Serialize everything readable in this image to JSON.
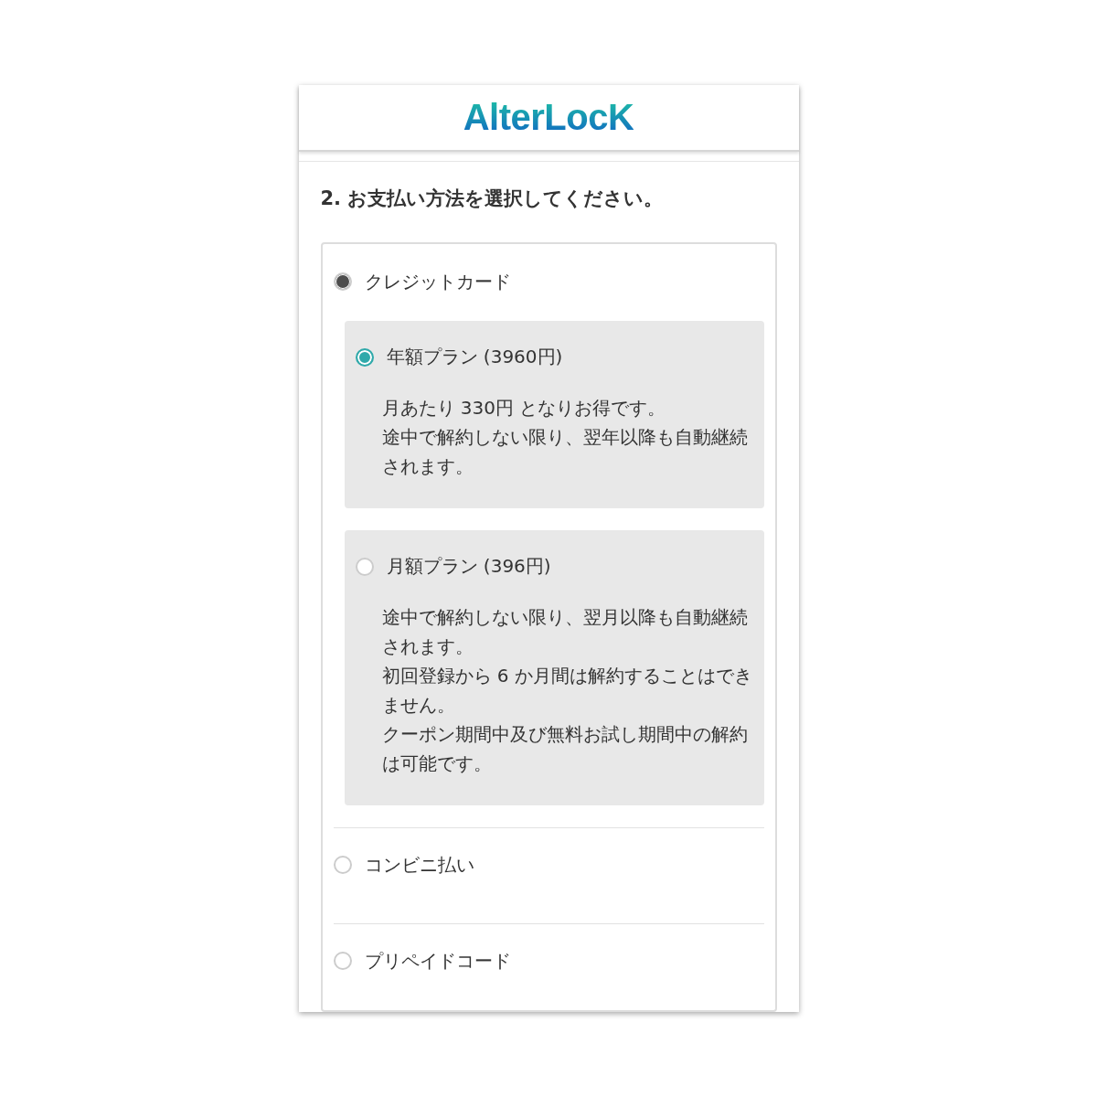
{
  "header": {
    "logo": "AlterLocK"
  },
  "heading": "2. お支払い方法を選択してください。",
  "payment_methods": [
    {
      "label": "クレジットカード",
      "selected": true,
      "plans": [
        {
          "label": "年額プラン (3960円)",
          "selected": true,
          "description": [
            "月あたり 330円 となりお得です。",
            "途中で解約しない限り、翌年以降も自動継続されます。"
          ]
        },
        {
          "label": "月額プラン (396円)",
          "selected": false,
          "description": [
            "途中で解約しない限り、翌月以降も自動継続されます。",
            "初回登録から 6 か月間は解約することはできません。",
            "クーポン期間中及び無料お試し期間中の解約は可能です。"
          ]
        }
      ]
    },
    {
      "label": "コンビニ払い",
      "selected": false
    },
    {
      "label": "プリペイドコード",
      "selected": false
    }
  ]
}
